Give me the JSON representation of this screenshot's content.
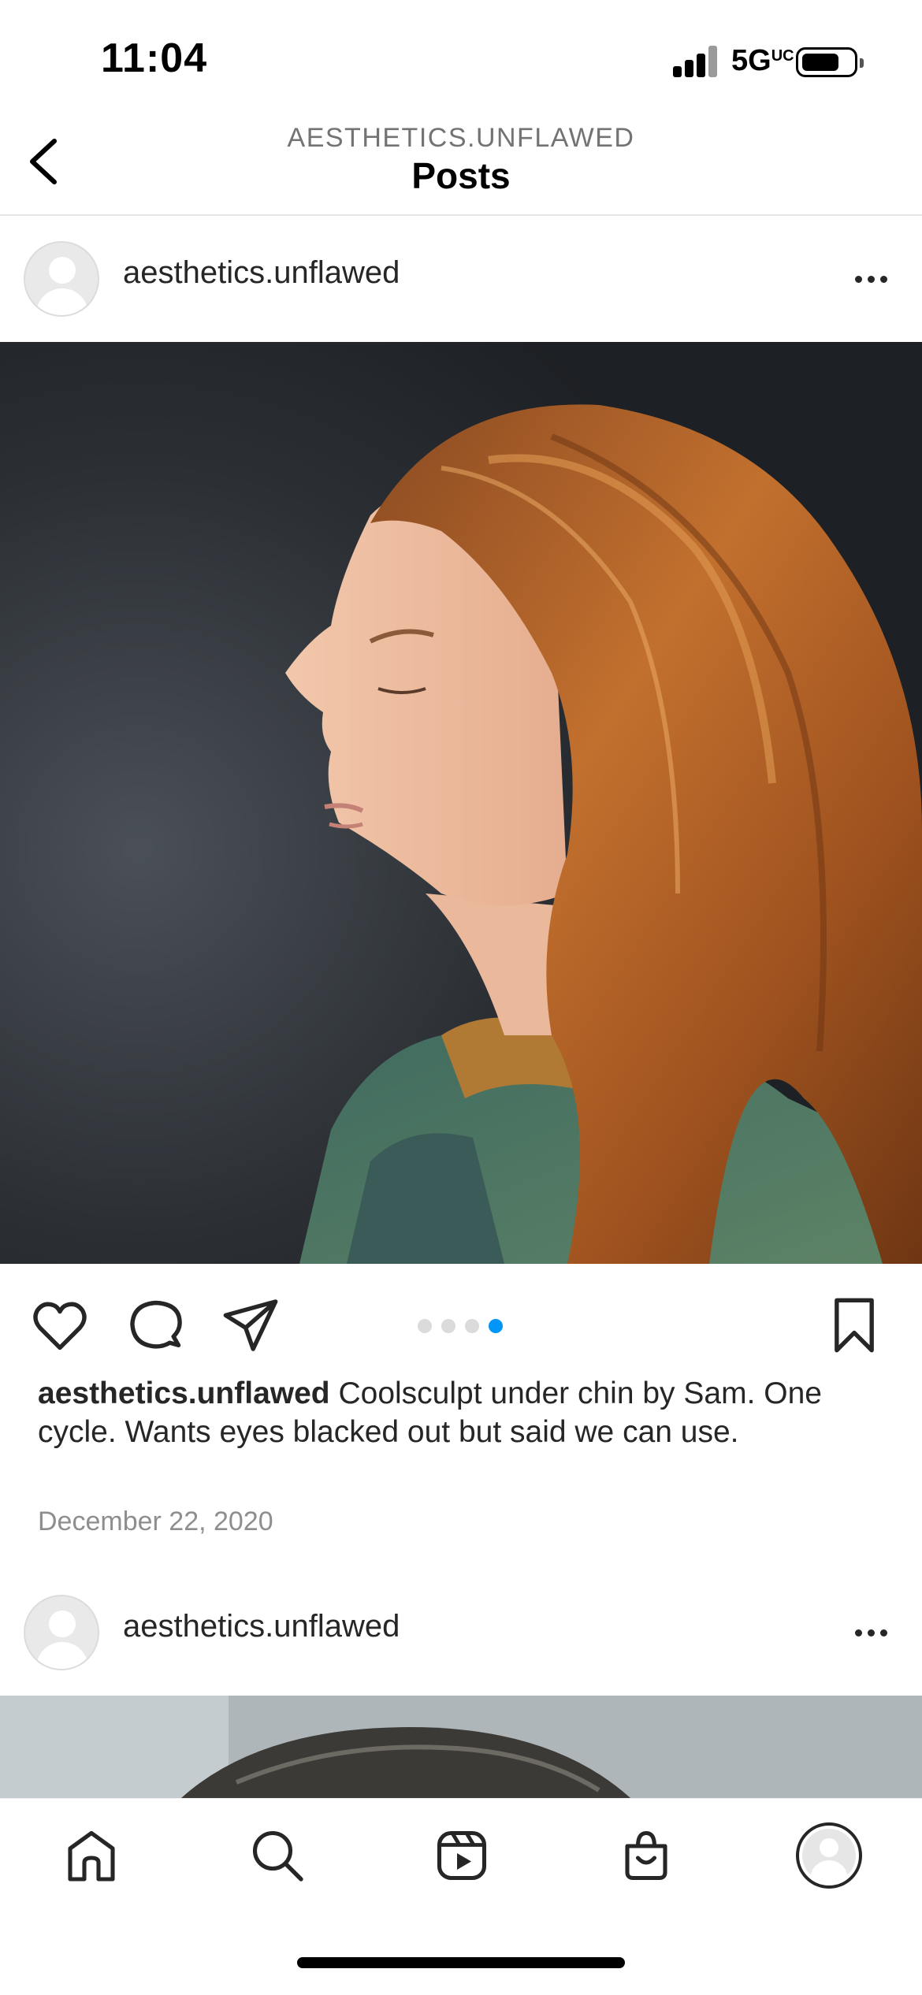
{
  "status_bar": {
    "time": "11:04",
    "network": "5G",
    "network_suffix": "UC"
  },
  "header": {
    "subtitle": "AESTHETICS.UNFLAWED",
    "title": "Posts"
  },
  "posts": [
    {
      "username": "aesthetics.unflawed",
      "carousel": {
        "count": 4,
        "active_index": 4
      },
      "caption_user": "aesthetics.unflawed",
      "caption_text": " Coolsculpt under chin by Sam. One cycle. Wants eyes blacked out but said we can use.",
      "date": "December 22, 2020"
    },
    {
      "username": "aesthetics.unflawed"
    }
  ],
  "colors": {
    "accent": "#0095f6",
    "text": "#262626",
    "muted": "#8e8e8e"
  },
  "icons": [
    "back-icon",
    "more-icon",
    "heart-icon",
    "comment-icon",
    "share-icon",
    "bookmark-icon",
    "home-icon",
    "search-icon",
    "reels-icon",
    "shop-icon",
    "profile-icon"
  ]
}
